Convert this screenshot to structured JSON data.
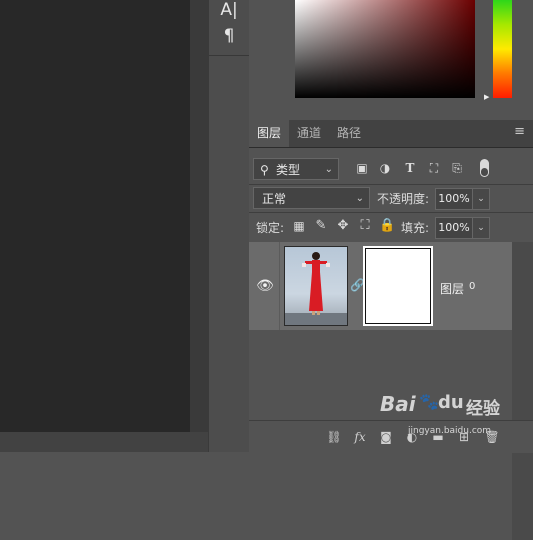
{
  "tools": {
    "type_tool_glyph": "A|",
    "paragraph_tool_glyph": "¶"
  },
  "colors": {
    "accent_red": "#6b0000",
    "layer_selected": "#6b6b6b",
    "panel": "#535353"
  },
  "layers_panel": {
    "tabs": [
      {
        "label": "图层",
        "active": true
      },
      {
        "label": "通道",
        "active": false
      },
      {
        "label": "路径",
        "active": false
      }
    ],
    "menu_glyph": "≡",
    "filter": {
      "search_glyph": "⚲",
      "kind_label": "类型"
    },
    "filter_icons": [
      "image-filter-icon",
      "adjustment-filter-icon",
      "type-filter-icon",
      "shape-filter-icon",
      "smart-object-filter-icon"
    ],
    "blend_mode": "正常",
    "opacity_label": "不透明度:",
    "opacity_value": "100%",
    "lock_label": "锁定:",
    "fill_label": "填充:",
    "fill_value": "100%",
    "layers": [
      {
        "name": "图层",
        "index": "0",
        "visible": true,
        "has_mask": true
      }
    ],
    "bottom_icons": [
      "link-layers-icon",
      "fx-icon",
      "add-mask-icon",
      "adjustment-layer-icon",
      "new-group-icon",
      "new-layer-icon",
      "trash-icon"
    ],
    "fx_glyph": "fx"
  },
  "watermark": {
    "brand": "Bai",
    "paw": "du",
    "text": "经验",
    "url": "jingyan.baidu.com"
  }
}
